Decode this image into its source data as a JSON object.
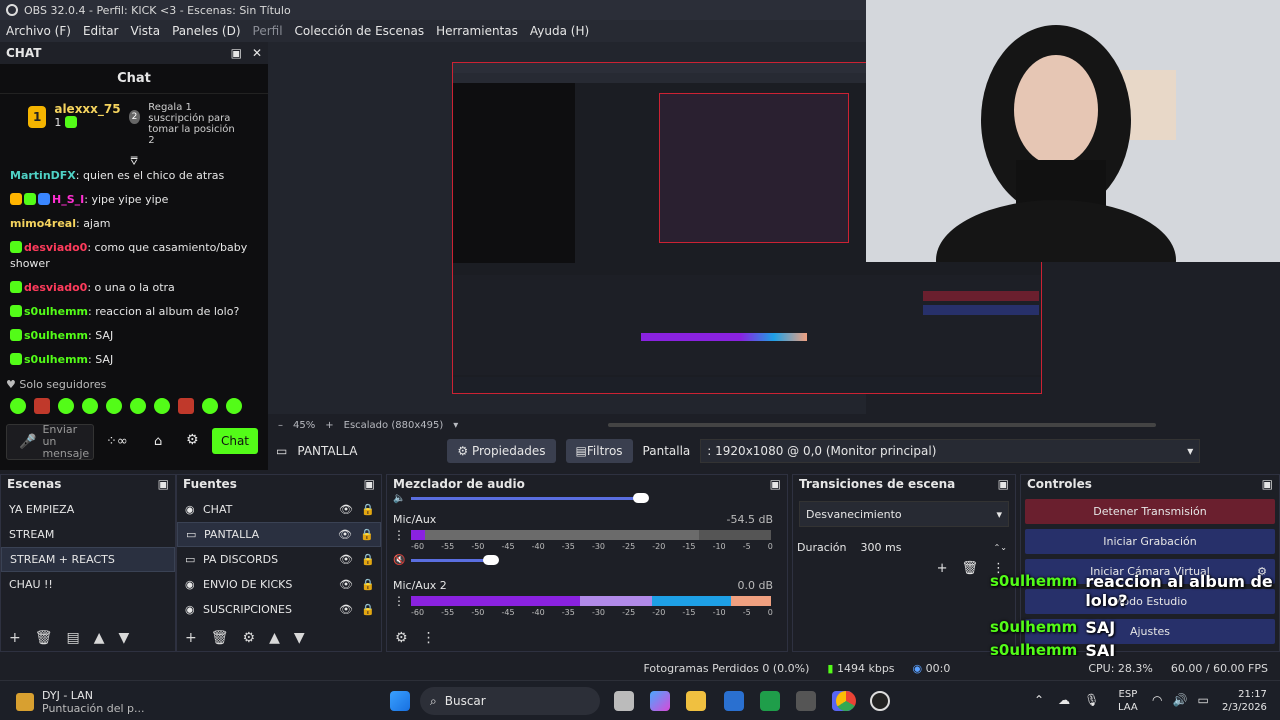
{
  "window": {
    "title": "OBS 32.0.4 - Perfil: KICK <3 - Escenas: Sin Título"
  },
  "menu": {
    "items": [
      "Archivo (F)",
      "Editar",
      "Vista",
      "Paneles (D)",
      "Perfil",
      "Colección de Escenas",
      "Herramientas",
      "Ayuda (H)"
    ]
  },
  "chat": {
    "dock_title": "CHAT",
    "title": "Chat",
    "top_user": {
      "rank": "1",
      "name": "alexxx_75",
      "count": "1"
    },
    "gift_promo": {
      "rank": "2",
      "text": "Regala 1 suscripción para tomar la posición 2"
    },
    "messages": [
      {
        "user": "MartinDFX",
        "text": "quien es el chico de atras"
      },
      {
        "user": "H_S_I",
        "text": "yipe yipe yipe"
      },
      {
        "user": "mimo4real",
        "text": "ajam"
      },
      {
        "user": "desviado0",
        "text": "como que casamiento/baby shower"
      },
      {
        "user": "desviado0",
        "text": "o una o la otra"
      },
      {
        "user": "s0ulhemm",
        "text": "reaccion al album de lolo?"
      },
      {
        "user": "s0ulhemm",
        "text": "SAJ"
      },
      {
        "user": "s0ulhemm",
        "text": "SAJ"
      }
    ],
    "followers_only": "Solo seguidores",
    "send_placeholder": "Enviar un mensaje",
    "send_button": "Chat"
  },
  "preview": {
    "zoom": "45%",
    "scaling": "Escalado (880x495)"
  },
  "source_bar": {
    "source": "PANTALLA",
    "properties": "Propiedades",
    "filters": "Filtros",
    "label": "Pantalla",
    "value": ": 1920x1080 @ 0,0 (Monitor principal)"
  },
  "scenes": {
    "title": "Escenas",
    "items": [
      "YA EMPIEZA",
      "STREAM",
      "STREAM + REACTS",
      "CHAU !!"
    ],
    "selected": 2
  },
  "sources": {
    "title": "Fuentes",
    "items": [
      "CHAT",
      "PANTALLA",
      "PA DISCORDS",
      "ENVIO DE KICKS",
      "SUSCRIPCIONES"
    ],
    "selected": 1
  },
  "mixer": {
    "title": "Mezclador de audio",
    "channels": [
      {
        "name": "Mic/Aux",
        "db": "-54.5 dB"
      },
      {
        "name": "Mic/Aux 2",
        "db": "0.0 dB"
      }
    ],
    "scale": [
      "-60",
      "-55",
      "-50",
      "-45",
      "-40",
      "-35",
      "-30",
      "-25",
      "-20",
      "-15",
      "-10",
      "-5",
      "0"
    ]
  },
  "transitions": {
    "title": "Transiciones de escena",
    "type": "Desvanecimiento",
    "duration_label": "Duración",
    "duration": "300 ms"
  },
  "controls": {
    "title": "Controles",
    "buttons": [
      "Detener Transmisión",
      "Iniciar Grabación",
      "Iniciar Cámara Virtual",
      "Modo Estudio",
      "Ajustes"
    ]
  },
  "overlay_chat": [
    {
      "user": "s0ulhemm",
      "text": "reaccion al album de lolo?"
    },
    {
      "user": "s0ulhemm",
      "text": "SAJ"
    },
    {
      "user": "s0ulhemm",
      "text": "SAJ"
    }
  ],
  "status": {
    "dropped": "Fotogramas Perdidos 0 (0.0%)",
    "bitrate": "1494 kbps",
    "time": "00:0",
    "cpu": "CPU: 28.3%",
    "fps": "60.00 / 60.00 FPS"
  },
  "taskbar": {
    "app_name": "DYJ - LAN",
    "app_sub": "Puntuación del p...",
    "search": "Buscar",
    "lang1": "ESP",
    "lang2": "LAA",
    "clock": "21:17",
    "date": "2/3/2026"
  },
  "colors": {
    "kick_green": "#53fc18",
    "stream_red": "#6a1f2e",
    "button_blue": "#27306a"
  }
}
